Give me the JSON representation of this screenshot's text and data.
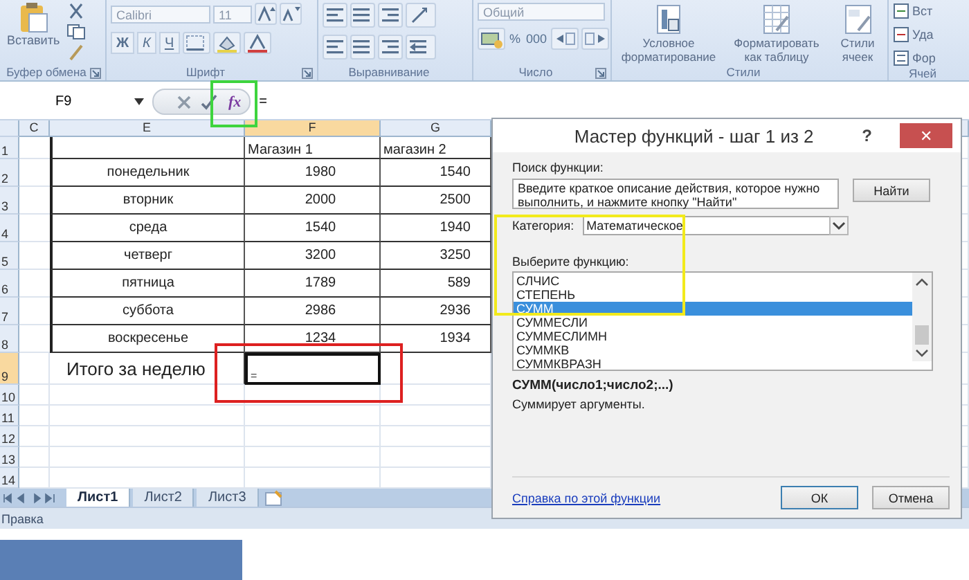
{
  "ribbon": {
    "groups": [
      {
        "kind": "clipboard",
        "label": "Буфер обмена",
        "paste": "Вставить"
      },
      {
        "kind": "font",
        "label": "Шрифт",
        "font": "Calibri",
        "size": "11",
        "styles": [
          "Ж",
          "К",
          "Ч"
        ]
      },
      {
        "kind": "alignment",
        "label": "Выравнивание"
      },
      {
        "kind": "number",
        "label": "Число",
        "format": "Общий",
        "symbols": [
          "%",
          "000"
        ]
      },
      {
        "kind": "styles",
        "label": "Стили",
        "buttons": [
          "Условное форматирование",
          "Форматировать как таблицу",
          "Стили ячеек"
        ]
      },
      {
        "kind": "cells",
        "label": "Ячей",
        "buttons": [
          "Вст",
          "Уда",
          "Фор"
        ]
      }
    ]
  },
  "formula_bar": {
    "cell": "F9",
    "insert_function": "fx",
    "formula": "="
  },
  "sheet": {
    "columns": [
      {
        "label": "C",
        "selected": false
      },
      {
        "label": "E",
        "selected": false
      },
      {
        "label": "F",
        "selected": true
      },
      {
        "label": "G",
        "selected": false
      }
    ],
    "rows": [
      {
        "number": "1",
        "kind": "header",
        "selected": false,
        "cells": {
          "f": "Магазин 1",
          "g": "магазин 2"
        }
      },
      {
        "number": "2",
        "kind": "data",
        "selected": false,
        "cells": {
          "e": "понедельник",
          "f": "1980",
          "g": "1540"
        }
      },
      {
        "number": "3",
        "kind": "data",
        "selected": false,
        "cells": {
          "e": "вторник",
          "f": "2000",
          "g": "2500"
        }
      },
      {
        "number": "4",
        "kind": "data",
        "selected": false,
        "cells": {
          "e": "среда",
          "f": "1540",
          "g": "1940"
        }
      },
      {
        "number": "5",
        "kind": "data",
        "selected": false,
        "cells": {
          "e": "четверг",
          "f": "3200",
          "g": "3250"
        }
      },
      {
        "number": "6",
        "kind": "data",
        "selected": false,
        "cells": {
          "e": "пятница",
          "f": "1789",
          "g": "589"
        }
      },
      {
        "number": "7",
        "kind": "data",
        "selected": false,
        "cells": {
          "e": "суббота",
          "f": "2986",
          "g": "2936"
        }
      },
      {
        "number": "8",
        "kind": "data",
        "selected": false,
        "cells": {
          "e": "воскресенье",
          "f": "1234",
          "g": "1934"
        }
      },
      {
        "number": "9",
        "kind": "total",
        "selected": true,
        "cells": {
          "e": "Итого за неделю",
          "f": "="
        }
      },
      {
        "number": "10",
        "kind": "empty",
        "selected": false
      },
      {
        "number": "11",
        "kind": "empty",
        "selected": false
      },
      {
        "number": "12",
        "kind": "empty",
        "selected": false
      },
      {
        "number": "13",
        "kind": "empty",
        "selected": false
      },
      {
        "number": "14",
        "kind": "empty",
        "selected": false
      }
    ]
  },
  "sheet_tabs": [
    {
      "label": "Лист1",
      "selected": true
    },
    {
      "label": "Лист2",
      "selected": false
    },
    {
      "label": "Лист3",
      "selected": false
    }
  ],
  "status_bar": {
    "mode": "Правка"
  },
  "dialog": {
    "title": "Мастер функций - шаг 1 из 2",
    "help": "?",
    "close": "✕",
    "search_label": "Поиск функции:",
    "search_value": "Введите краткое описание действия, которое нужно выполнить, и нажмите кнопку \"Найти\"",
    "find_button": "Найти",
    "category_label": "Категория:",
    "category_value": "Математическое",
    "list_label": "Выберите функцию:",
    "functions": [
      {
        "name": "СЛЧИС",
        "selected": false
      },
      {
        "name": "СТЕПЕНЬ",
        "selected": false
      },
      {
        "name": "СУММ",
        "selected": true
      },
      {
        "name": "СУММЕСЛИ",
        "selected": false
      },
      {
        "name": "СУММЕСЛИМН",
        "selected": false
      },
      {
        "name": "СУММКВ",
        "selected": false
      },
      {
        "name": "СУММКВРАЗН",
        "selected": false
      }
    ],
    "signature": "СУММ(число1;число2;...)",
    "description": "Суммирует аргументы.",
    "help_link": "Справка по этой функции",
    "buttons": [
      "ОК",
      "Отмена"
    ]
  },
  "highlights": [
    {
      "kind": "insert-function",
      "color": "#3ed43e"
    },
    {
      "kind": "active-cell",
      "color": "#dd2020"
    },
    {
      "kind": "category",
      "color": "#f2ea1c"
    }
  ]
}
